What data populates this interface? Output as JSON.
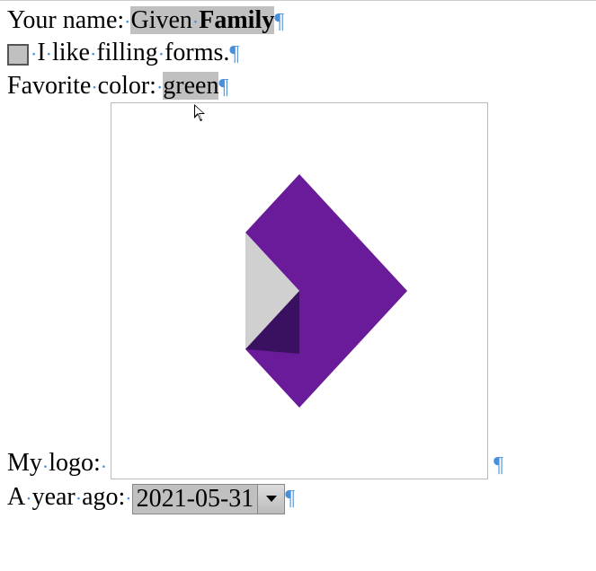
{
  "lines": {
    "name": {
      "label": "Your name:",
      "given": "Given",
      "family": "Family"
    },
    "checkbox": {
      "text": "I like filling forms."
    },
    "color": {
      "label": "Favorite color:",
      "value": "green"
    },
    "logo": {
      "label": "My logo:"
    },
    "date": {
      "label": "A year ago:",
      "value": "2021-05-31"
    }
  },
  "marks": {
    "space_dot": "·",
    "pilcrow": "¶"
  }
}
